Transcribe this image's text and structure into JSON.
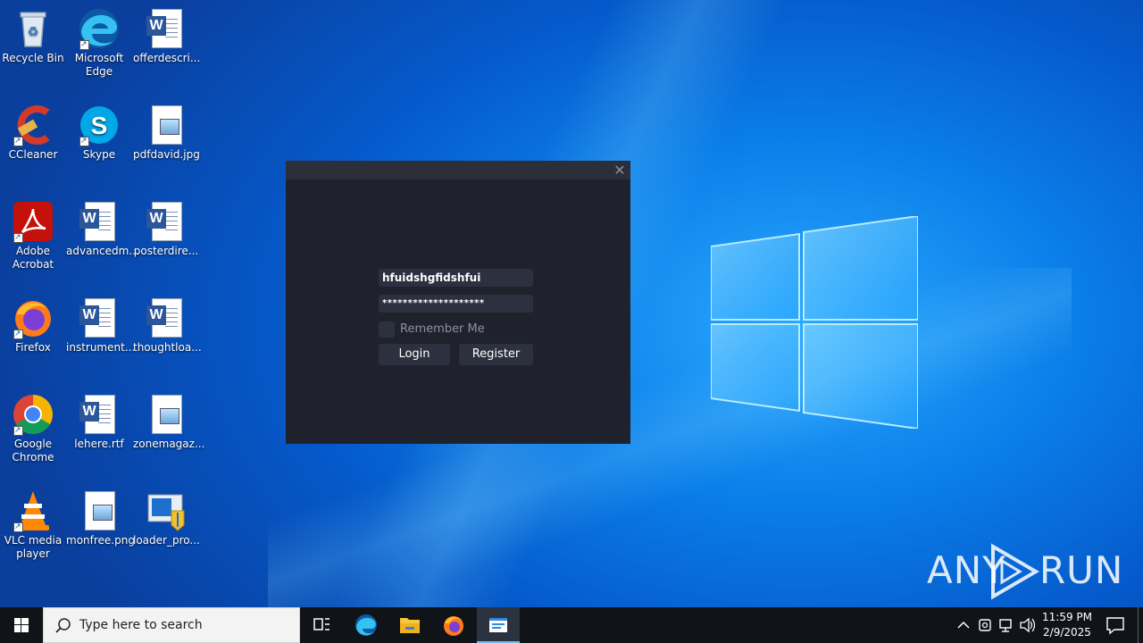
{
  "desktop": {
    "icons": [
      {
        "label": "Recycle Bin"
      },
      {
        "label": "Microsoft Edge"
      },
      {
        "label": "offerdescri..."
      },
      {
        "label": "CCleaner"
      },
      {
        "label": "Skype"
      },
      {
        "label": "pdfdavid.jpg"
      },
      {
        "label": "Adobe Acrobat"
      },
      {
        "label": "advancedm..."
      },
      {
        "label": "posterdire..."
      },
      {
        "label": "Firefox"
      },
      {
        "label": "instrument..."
      },
      {
        "label": "thoughtloa..."
      },
      {
        "label": "Google Chrome"
      },
      {
        "label": "lehere.rtf"
      },
      {
        "label": "zonemagaz..."
      },
      {
        "label": "VLC media player"
      },
      {
        "label": "monfree.png"
      },
      {
        "label": "loader_pro..."
      }
    ]
  },
  "dialog": {
    "close_glyph": "✕",
    "username_value": "hfuidshgfidshfui",
    "password_value": "********************",
    "remember_label": "Remember Me",
    "remember_checked": false,
    "login_label": "Login",
    "register_label": "Register"
  },
  "watermark": {
    "left": "ANY",
    "right": "RUN"
  },
  "taskbar": {
    "search_placeholder": "Type here to search",
    "clock_time": "11:59 PM",
    "clock_date": "2/9/2025"
  },
  "colors": {
    "dialog_bg": "#1f222d",
    "field_bg": "#2c303f",
    "taskbar_bg": "#101418",
    "accent": "#76b9ed"
  }
}
